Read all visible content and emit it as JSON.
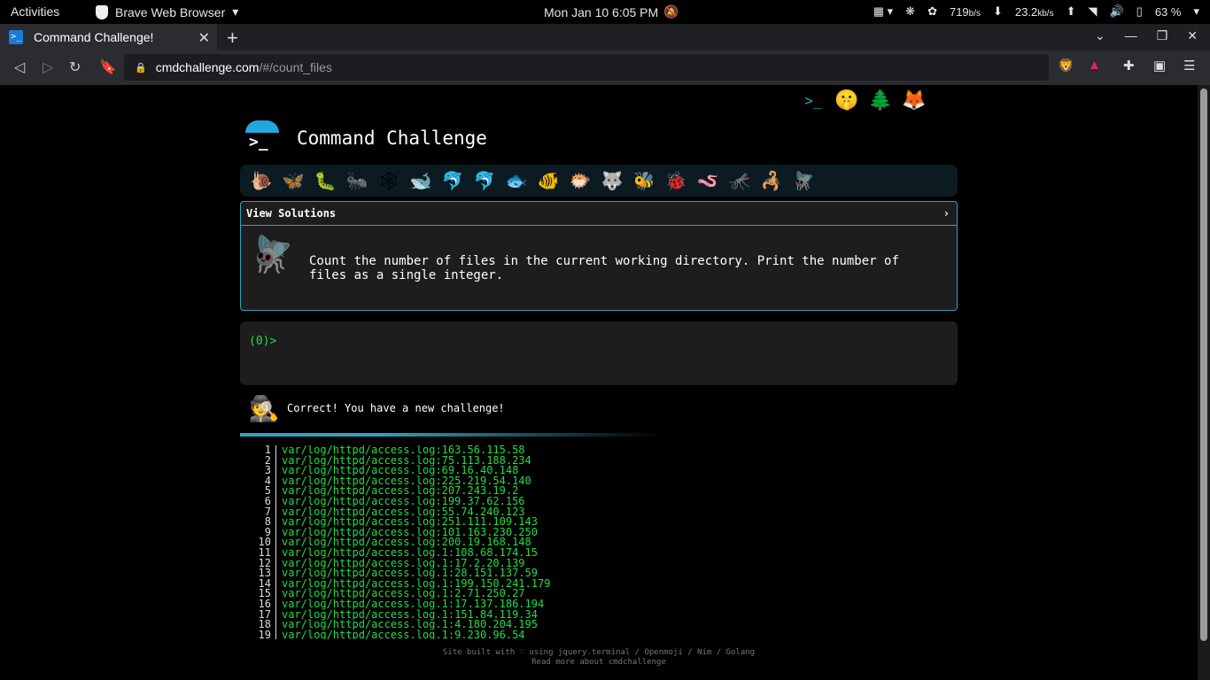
{
  "system_bar": {
    "activities": "Activities",
    "app_name": "Brave Web Browser",
    "clock": "Mon Jan 10  6:05 PM",
    "net_up": "719",
    "net_up_unit": "b/s",
    "net_down": "23.2",
    "net_down_unit": "kb/s",
    "battery": "63 %"
  },
  "browser": {
    "tab_title": "Command Challenge!",
    "url_domain": "cmdchallenge.com",
    "url_path": "/#/count_files"
  },
  "page": {
    "title": "Command Challenge",
    "view_solutions": "View Solutions",
    "challenge_text": "Count the number of files in the current working directory. Print the number of files as a single integer.",
    "prompt": "(0)>",
    "result_message": "Correct! You have a new challenge!",
    "progress_fraction": 0.55,
    "output_lines": [
      {
        "n": "1",
        "t": "var/log/httpd/access.log:163.56.115.58"
      },
      {
        "n": "2",
        "t": "var/log/httpd/access.log:75.113.188.234"
      },
      {
        "n": "3",
        "t": "var/log/httpd/access.log:69.16.40.148"
      },
      {
        "n": "4",
        "t": "var/log/httpd/access.log:225.219.54.140"
      },
      {
        "n": "5",
        "t": "var/log/httpd/access.log:207.243.19.2"
      },
      {
        "n": "6",
        "t": "var/log/httpd/access.log:199.37.62.156"
      },
      {
        "n": "7",
        "t": "var/log/httpd/access.log:55.74.240.123"
      },
      {
        "n": "8",
        "t": "var/log/httpd/access.log:251.111.109.143"
      },
      {
        "n": "9",
        "t": "var/log/httpd/access.log:101.163.230.250"
      },
      {
        "n": "10",
        "t": "var/log/httpd/access.log:200.19.168.148"
      },
      {
        "n": "11",
        "t": "var/log/httpd/access.log.1:108.68.174.15"
      },
      {
        "n": "12",
        "t": "var/log/httpd/access.log.1:17.2.20.139"
      },
      {
        "n": "13",
        "t": "var/log/httpd/access.log.1:28.151.137.59"
      },
      {
        "n": "14",
        "t": "var/log/httpd/access.log.1:199.150.241.179"
      },
      {
        "n": "15",
        "t": "var/log/httpd/access.log.1:2.71.250.27"
      },
      {
        "n": "16",
        "t": "var/log/httpd/access.log.1:17.137.186.194"
      },
      {
        "n": "17",
        "t": "var/log/httpd/access.log.1:151.84.119.34"
      },
      {
        "n": "18",
        "t": "var/log/httpd/access.log.1:4.180.204.195"
      },
      {
        "n": "19",
        "t": "var/log/httpd/access.log.1:9.230.96.54"
      }
    ],
    "footer_line1": "Site built with ♡ using jquery.terminal / Openmoji / Nim / Golang",
    "footer_line2": "Read more about cmdchallenge"
  },
  "icons": {
    "top": [
      "terminal-logo-icon",
      "shushing-face-icon",
      "tree-icon",
      "gitlab-icon",
      "mail-icon"
    ],
    "levels": [
      "snail",
      "butterfly",
      "caterpillar",
      "ant",
      "spider-web",
      "whale",
      "dolphin",
      "dolphin",
      "fish",
      "tropical-fish",
      "blowfish",
      "wolf",
      "bee",
      "lady-beetle",
      "worm",
      "mosquito",
      "scorpion",
      "fly"
    ]
  },
  "colors": {
    "accent_blue": "#2ea3c4",
    "terminal_green": "#22dd44",
    "panel_bg": "#1d1d1d"
  }
}
